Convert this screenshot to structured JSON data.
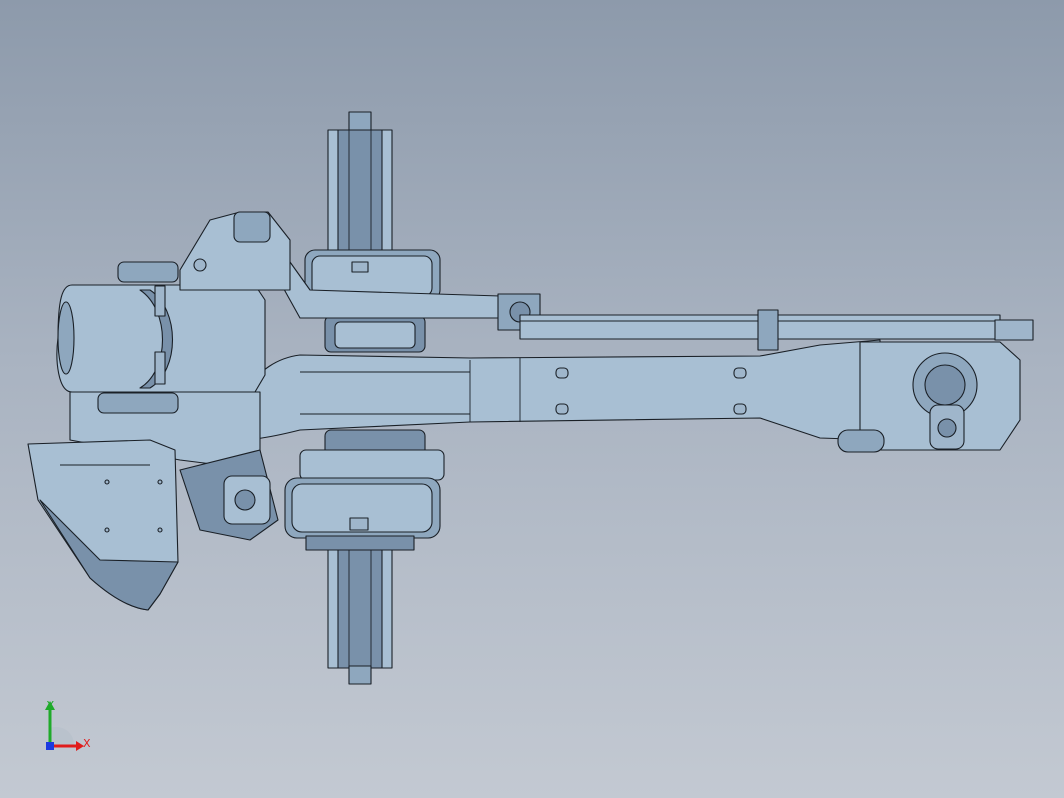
{
  "viewport": {
    "background_top": "#8d9aab",
    "background_bottom": "#c3c9d2"
  },
  "model": {
    "part_color": "#a8bfd3",
    "shade_color": "#7991aa",
    "edge_color": "#1a2027"
  },
  "triad": {
    "x_label": "X",
    "y_label": "Y",
    "x_color": "#e01c1c",
    "y_color": "#1faa2a",
    "z_color": "#1c3ae0"
  }
}
